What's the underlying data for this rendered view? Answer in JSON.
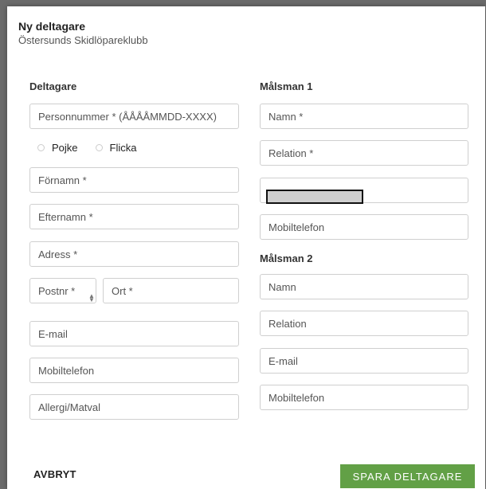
{
  "dialog": {
    "title": "Ny deltagare",
    "subtitle": "Östersunds Skidlöpareklubb"
  },
  "participant": {
    "heading": "Deltagare",
    "personnummer_placeholder": "Personnummer * (ÅÅÅÅMMDD-XXXX)",
    "gender_options": [
      "Pojke",
      "Flicka"
    ],
    "firstname_placeholder": "Förnamn *",
    "lastname_placeholder": "Efternamn *",
    "address_placeholder": "Adress *",
    "postnr_placeholder": "Postnr *",
    "city_placeholder": "Ort *",
    "email_placeholder": "E-mail",
    "mobile_placeholder": "Mobiltelefon",
    "allergy_placeholder": "Allergi/Matval"
  },
  "guardian1": {
    "heading": "Målsman 1",
    "name_placeholder": "Namn *",
    "relation_placeholder": "Relation *",
    "mobile_placeholder": "Mobiltelefon"
  },
  "guardian2": {
    "heading": "Målsman 2",
    "name_placeholder": "Namn",
    "relation_placeholder": "Relation",
    "email_placeholder": "E-mail",
    "mobile_placeholder": "Mobiltelefon"
  },
  "actions": {
    "cancel_label": "AVBRYT",
    "save_label": "SPARA DELTAGARE",
    "save_color": "#62a046"
  }
}
